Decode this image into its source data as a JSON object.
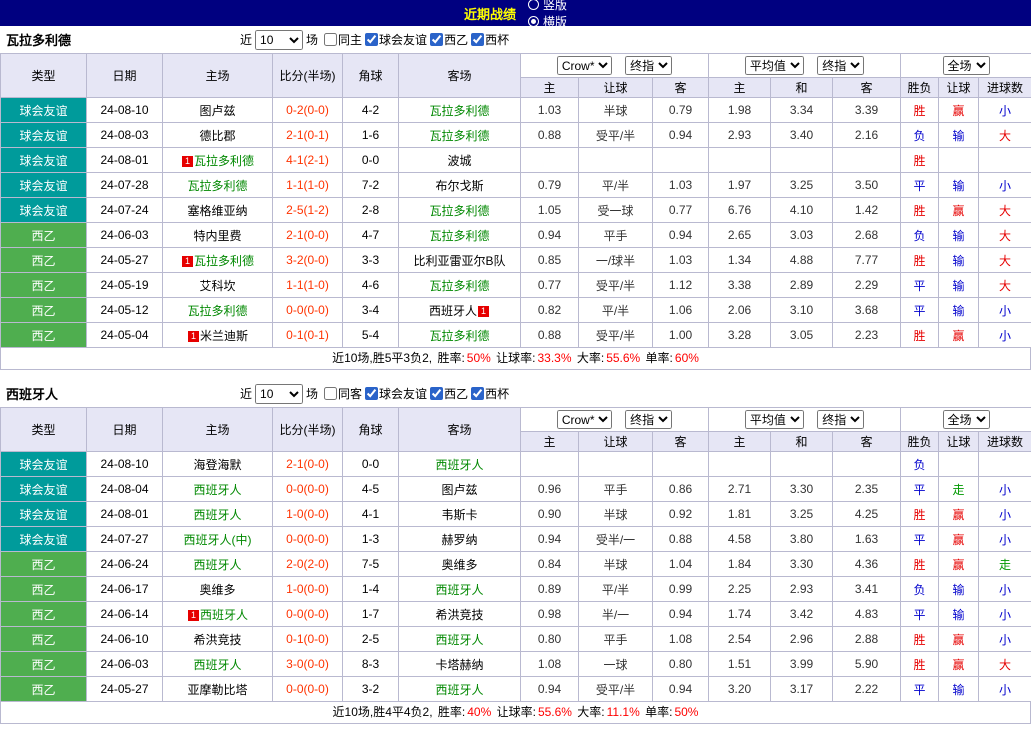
{
  "topbar": {
    "title": "近期战绩",
    "radios": [
      {
        "label": "竖版",
        "selected": false
      },
      {
        "label": "横版",
        "selected": true
      }
    ]
  },
  "colors": {
    "topbar_bg": "#000080",
    "topbar_title": "#ffff00",
    "header_bg": "#e6e6f5",
    "grid_border": "#b9b9d0",
    "friendly_type_bg": "#009b9b",
    "league_type_bg": "#4fae4f",
    "score_text": "#ff3300",
    "highlight_team": "#008800",
    "result_positive": "#e60000",
    "result_negative": "#0000cc",
    "result_push": "#009900",
    "stat_value": "#ff0000"
  },
  "table_header": {
    "main_cols": [
      "类型",
      "日期",
      "主场",
      "比分(半场)",
      "角球",
      "客场"
    ],
    "dropdowns": [
      "Crow*",
      "终指",
      "平均值",
      "终指",
      "全场"
    ],
    "sub_cols": [
      "主",
      "让球",
      "客",
      "主",
      "和",
      "客",
      "胜负",
      "让球",
      "进球数"
    ]
  },
  "sections": [
    {
      "team": "瓦拉多利德",
      "filter": {
        "near_label": "近",
        "count": "10",
        "games_label": "场",
        "checkboxes": [
          {
            "label": "同主",
            "checked": false
          },
          {
            "label": "球会友谊",
            "checked": true
          },
          {
            "label": "西乙",
            "checked": true
          },
          {
            "label": "西杯",
            "checked": true
          }
        ]
      },
      "rows": [
        {
          "type": "球会友谊",
          "type_class": "friendly",
          "date": "24-08-10",
          "home": "图卢兹",
          "home_hl": false,
          "home_mark": "",
          "score": "0-2(0-0)",
          "corner": "4-2",
          "away": "瓦拉多利德",
          "away_hl": true,
          "away_mark": "",
          "asian_odds": [
            "1.03",
            "半球",
            "0.79"
          ],
          "euro_odds": [
            "1.98",
            "3.34",
            "3.39"
          ],
          "results": [
            [
              "胜",
              "pos"
            ],
            [
              "赢",
              "pos"
            ],
            [
              "小",
              "neg"
            ]
          ]
        },
        {
          "type": "球会友谊",
          "type_class": "friendly",
          "date": "24-08-03",
          "home": "德比郡",
          "home_hl": false,
          "home_mark": "",
          "score": "2-1(0-1)",
          "corner": "1-6",
          "away": "瓦拉多利德",
          "away_hl": true,
          "away_mark": "",
          "asian_odds": [
            "0.88",
            "受平/半",
            "0.94"
          ],
          "euro_odds": [
            "2.93",
            "3.40",
            "2.16"
          ],
          "results": [
            [
              "负",
              "neg"
            ],
            [
              "输",
              "neg"
            ],
            [
              "大",
              "pos"
            ]
          ]
        },
        {
          "type": "球会友谊",
          "type_class": "friendly",
          "date": "24-08-01",
          "home": "瓦拉多利德",
          "home_hl": true,
          "home_mark": "1",
          "score": "4-1(2-1)",
          "corner": "0-0",
          "away": "波城",
          "away_hl": false,
          "away_mark": "",
          "asian_odds": [
            "",
            "",
            ""
          ],
          "euro_odds": [
            "",
            "",
            ""
          ],
          "results": [
            [
              "胜",
              "pos"
            ],
            [
              "",
              ""
            ],
            [
              "",
              ""
            ]
          ]
        },
        {
          "type": "球会友谊",
          "type_class": "friendly",
          "date": "24-07-28",
          "home": "瓦拉多利德",
          "home_hl": true,
          "home_mark": "",
          "score": "1-1(1-0)",
          "corner": "7-2",
          "away": "布尔戈斯",
          "away_hl": false,
          "away_mark": "",
          "asian_odds": [
            "0.79",
            "平/半",
            "1.03"
          ],
          "euro_odds": [
            "1.97",
            "3.25",
            "3.50"
          ],
          "results": [
            [
              "平",
              "neg"
            ],
            [
              "输",
              "neg"
            ],
            [
              "小",
              "neg"
            ]
          ]
        },
        {
          "type": "球会友谊",
          "type_class": "friendly",
          "date": "24-07-24",
          "home": "塞格维亚纳",
          "home_hl": false,
          "home_mark": "",
          "score": "2-5(1-2)",
          "corner": "2-8",
          "away": "瓦拉多利德",
          "away_hl": true,
          "away_mark": "",
          "asian_odds": [
            "1.05",
            "受一球",
            "0.77"
          ],
          "euro_odds": [
            "6.76",
            "4.10",
            "1.42"
          ],
          "results": [
            [
              "胜",
              "pos"
            ],
            [
              "赢",
              "pos"
            ],
            [
              "大",
              "pos"
            ]
          ]
        },
        {
          "type": "西乙",
          "type_class": "league",
          "date": "24-06-03",
          "home": "特内里费",
          "home_hl": false,
          "home_mark": "",
          "score": "2-1(0-0)",
          "corner": "4-7",
          "away": "瓦拉多利德",
          "away_hl": true,
          "away_mark": "",
          "asian_odds": [
            "0.94",
            "平手",
            "0.94"
          ],
          "euro_odds": [
            "2.65",
            "3.03",
            "2.68"
          ],
          "results": [
            [
              "负",
              "neg"
            ],
            [
              "输",
              "neg"
            ],
            [
              "大",
              "pos"
            ]
          ]
        },
        {
          "type": "西乙",
          "type_class": "league",
          "date": "24-05-27",
          "home": "瓦拉多利德",
          "home_hl": true,
          "home_mark": "1",
          "score": "3-2(0-0)",
          "corner": "3-3",
          "away": "比利亚雷亚尔B队",
          "away_hl": false,
          "away_mark": "",
          "asian_odds": [
            "0.85",
            "一/球半",
            "1.03"
          ],
          "euro_odds": [
            "1.34",
            "4.88",
            "7.77"
          ],
          "results": [
            [
              "胜",
              "pos"
            ],
            [
              "输",
              "neg"
            ],
            [
              "大",
              "pos"
            ]
          ]
        },
        {
          "type": "西乙",
          "type_class": "league",
          "date": "24-05-19",
          "home": "艾科坎",
          "home_hl": false,
          "home_mark": "",
          "score": "1-1(1-0)",
          "corner": "4-6",
          "away": "瓦拉多利德",
          "away_hl": true,
          "away_mark": "",
          "asian_odds": [
            "0.77",
            "受平/半",
            "1.12"
          ],
          "euro_odds": [
            "3.38",
            "2.89",
            "2.29"
          ],
          "results": [
            [
              "平",
              "neg"
            ],
            [
              "输",
              "neg"
            ],
            [
              "大",
              "pos"
            ]
          ]
        },
        {
          "type": "西乙",
          "type_class": "league",
          "date": "24-05-12",
          "home": "瓦拉多利德",
          "home_hl": true,
          "home_mark": "",
          "score": "0-0(0-0)",
          "corner": "3-4",
          "away": "西班牙人",
          "away_hl": false,
          "away_mark": "1",
          "asian_odds": [
            "0.82",
            "平/半",
            "1.06"
          ],
          "euro_odds": [
            "2.06",
            "3.10",
            "3.68"
          ],
          "results": [
            [
              "平",
              "neg"
            ],
            [
              "输",
              "neg"
            ],
            [
              "小",
              "neg"
            ]
          ]
        },
        {
          "type": "西乙",
          "type_class": "league",
          "date": "24-05-04",
          "home": "米兰迪斯",
          "home_hl": false,
          "home_mark": "1",
          "score": "0-1(0-1)",
          "corner": "5-4",
          "away": "瓦拉多利德",
          "away_hl": true,
          "away_mark": "",
          "asian_odds": [
            "0.88",
            "受平/半",
            "1.00"
          ],
          "euro_odds": [
            "3.28",
            "3.05",
            "2.23"
          ],
          "results": [
            [
              "胜",
              "pos"
            ],
            [
              "赢",
              "pos"
            ],
            [
              "小",
              "neg"
            ]
          ]
        }
      ],
      "summary": {
        "prefix": "近10场,胜5平3负2,",
        "stats": [
          {
            "label": "胜率:",
            "value": "50%"
          },
          {
            "label": "让球率:",
            "value": "33.3%"
          },
          {
            "label": "大率:",
            "value": "55.6%"
          },
          {
            "label": "单率:",
            "value": "60%"
          }
        ]
      }
    },
    {
      "team": "西班牙人",
      "filter": {
        "near_label": "近",
        "count": "10",
        "games_label": "场",
        "checkboxes": [
          {
            "label": "同客",
            "checked": false
          },
          {
            "label": "球会友谊",
            "checked": true
          },
          {
            "label": "西乙",
            "checked": true
          },
          {
            "label": "西杯",
            "checked": true
          }
        ]
      },
      "rows": [
        {
          "type": "球会友谊",
          "type_class": "friendly",
          "date": "24-08-10",
          "home": "海登海默",
          "home_hl": false,
          "home_mark": "",
          "score": "2-1(0-0)",
          "corner": "0-0",
          "away": "西班牙人",
          "away_hl": true,
          "away_mark": "",
          "asian_odds": [
            "",
            "",
            ""
          ],
          "euro_odds": [
            "",
            "",
            ""
          ],
          "results": [
            [
              "负",
              "neg"
            ],
            [
              "",
              ""
            ],
            [
              "",
              ""
            ]
          ]
        },
        {
          "type": "球会友谊",
          "type_class": "friendly",
          "date": "24-08-04",
          "home": "西班牙人",
          "home_hl": true,
          "home_mark": "",
          "score": "0-0(0-0)",
          "corner": "4-5",
          "away": "图卢兹",
          "away_hl": false,
          "away_mark": "",
          "asian_odds": [
            "0.96",
            "平手",
            "0.86"
          ],
          "euro_odds": [
            "2.71",
            "3.30",
            "2.35"
          ],
          "results": [
            [
              "平",
              "neg"
            ],
            [
              "走",
              "push"
            ],
            [
              "小",
              "neg"
            ]
          ]
        },
        {
          "type": "球会友谊",
          "type_class": "friendly",
          "date": "24-08-01",
          "home": "西班牙人",
          "home_hl": true,
          "home_mark": "",
          "score": "1-0(0-0)",
          "corner": "4-1",
          "away": "韦斯卡",
          "away_hl": false,
          "away_mark": "",
          "asian_odds": [
            "0.90",
            "半球",
            "0.92"
          ],
          "euro_odds": [
            "1.81",
            "3.25",
            "4.25"
          ],
          "results": [
            [
              "胜",
              "pos"
            ],
            [
              "赢",
              "pos"
            ],
            [
              "小",
              "neg"
            ]
          ]
        },
        {
          "type": "球会友谊",
          "type_class": "friendly",
          "date": "24-07-27",
          "home": "西班牙人(中)",
          "home_hl": true,
          "home_mark": "",
          "score": "0-0(0-0)",
          "corner": "1-3",
          "away": "赫罗纳",
          "away_hl": false,
          "away_mark": "",
          "asian_odds": [
            "0.94",
            "受半/一",
            "0.88"
          ],
          "euro_odds": [
            "4.58",
            "3.80",
            "1.63"
          ],
          "results": [
            [
              "平",
              "neg"
            ],
            [
              "赢",
              "pos"
            ],
            [
              "小",
              "neg"
            ]
          ]
        },
        {
          "type": "西乙",
          "type_class": "league",
          "date": "24-06-24",
          "home": "西班牙人",
          "home_hl": true,
          "home_mark": "",
          "score": "2-0(2-0)",
          "corner": "7-5",
          "away": "奥维多",
          "away_hl": false,
          "away_mark": "",
          "asian_odds": [
            "0.84",
            "半球",
            "1.04"
          ],
          "euro_odds": [
            "1.84",
            "3.30",
            "4.36"
          ],
          "results": [
            [
              "胜",
              "pos"
            ],
            [
              "赢",
              "pos"
            ],
            [
              "走",
              "push"
            ]
          ]
        },
        {
          "type": "西乙",
          "type_class": "league",
          "date": "24-06-17",
          "home": "奥维多",
          "home_hl": false,
          "home_mark": "",
          "score": "1-0(0-0)",
          "corner": "1-4",
          "away": "西班牙人",
          "away_hl": true,
          "away_mark": "",
          "asian_odds": [
            "0.89",
            "平/半",
            "0.99"
          ],
          "euro_odds": [
            "2.25",
            "2.93",
            "3.41"
          ],
          "results": [
            [
              "负",
              "neg"
            ],
            [
              "输",
              "neg"
            ],
            [
              "小",
              "neg"
            ]
          ]
        },
        {
          "type": "西乙",
          "type_class": "league",
          "date": "24-06-14",
          "home": "西班牙人",
          "home_hl": true,
          "home_mark": "1",
          "score": "0-0(0-0)",
          "corner": "1-7",
          "away": "希洪竞技",
          "away_hl": false,
          "away_mark": "",
          "asian_odds": [
            "0.98",
            "半/一",
            "0.94"
          ],
          "euro_odds": [
            "1.74",
            "3.42",
            "4.83"
          ],
          "results": [
            [
              "平",
              "neg"
            ],
            [
              "输",
              "neg"
            ],
            [
              "小",
              "neg"
            ]
          ]
        },
        {
          "type": "西乙",
          "type_class": "league",
          "date": "24-06-10",
          "home": "希洪竞技",
          "home_hl": false,
          "home_mark": "",
          "score": "0-1(0-0)",
          "corner": "2-5",
          "away": "西班牙人",
          "away_hl": true,
          "away_mark": "",
          "asian_odds": [
            "0.80",
            "平手",
            "1.08"
          ],
          "euro_odds": [
            "2.54",
            "2.96",
            "2.88"
          ],
          "results": [
            [
              "胜",
              "pos"
            ],
            [
              "赢",
              "pos"
            ],
            [
              "小",
              "neg"
            ]
          ]
        },
        {
          "type": "西乙",
          "type_class": "league",
          "date": "24-06-03",
          "home": "西班牙人",
          "home_hl": true,
          "home_mark": "",
          "score": "3-0(0-0)",
          "corner": "8-3",
          "away": "卡塔赫纳",
          "away_hl": false,
          "away_mark": "",
          "asian_odds": [
            "1.08",
            "一球",
            "0.80"
          ],
          "euro_odds": [
            "1.51",
            "3.99",
            "5.90"
          ],
          "results": [
            [
              "胜",
              "pos"
            ],
            [
              "赢",
              "pos"
            ],
            [
              "大",
              "pos"
            ]
          ]
        },
        {
          "type": "西乙",
          "type_class": "league",
          "date": "24-05-27",
          "home": "亚摩勒比塔",
          "home_hl": false,
          "home_mark": "",
          "score": "0-0(0-0)",
          "corner": "3-2",
          "away": "西班牙人",
          "away_hl": true,
          "away_mark": "",
          "asian_odds": [
            "0.94",
            "受平/半",
            "0.94"
          ],
          "euro_odds": [
            "3.20",
            "3.17",
            "2.22"
          ],
          "results": [
            [
              "平",
              "neg"
            ],
            [
              "输",
              "neg"
            ],
            [
              "小",
              "neg"
            ]
          ]
        }
      ],
      "summary": {
        "prefix": "近10场,胜4平4负2,",
        "stats": [
          {
            "label": "胜率:",
            "value": "40%"
          },
          {
            "label": "让球率:",
            "value": "55.6%"
          },
          {
            "label": "大率:",
            "value": "11.1%"
          },
          {
            "label": "单率:",
            "value": "50%"
          }
        ]
      }
    }
  ]
}
